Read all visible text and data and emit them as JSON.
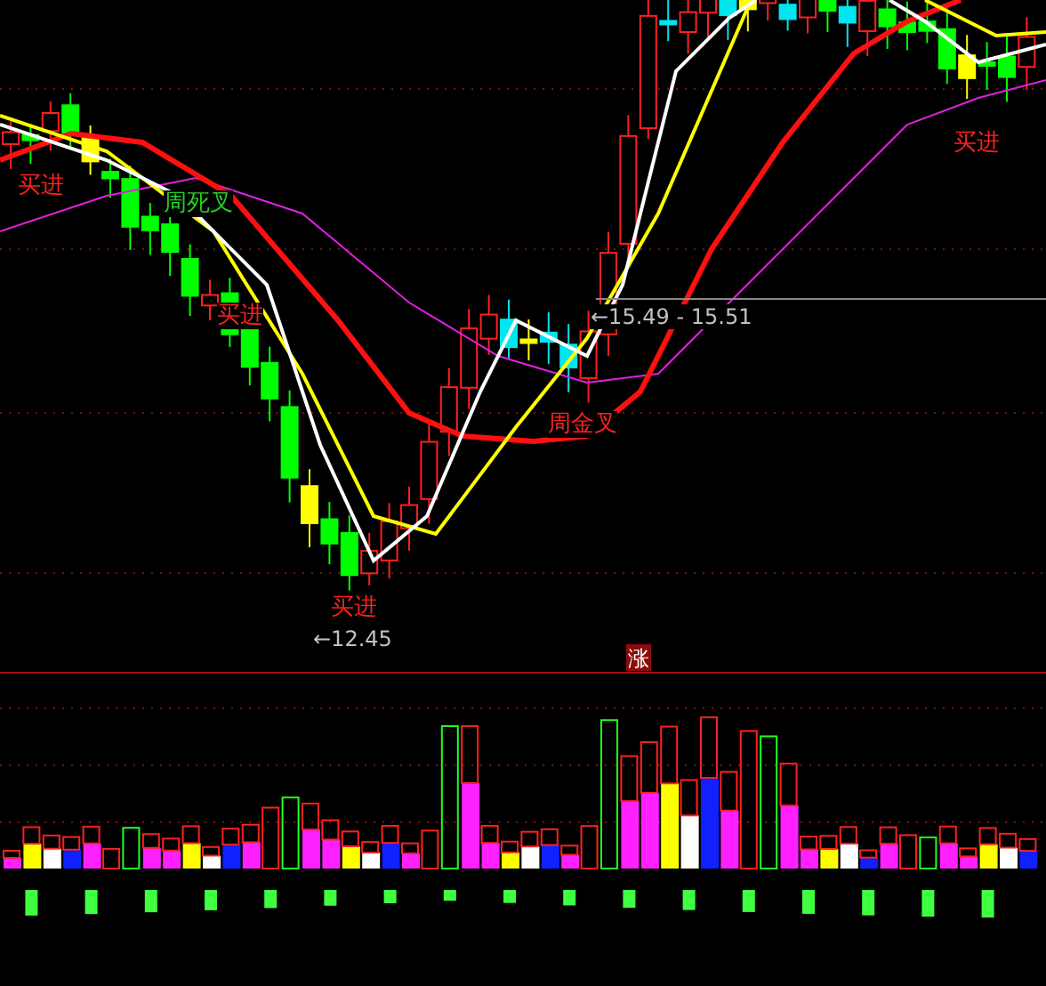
{
  "chart": {
    "annotations": [
      {
        "kind": "buy",
        "text": "买进"
      },
      {
        "kind": "dead-cross",
        "text": "周死叉"
      },
      {
        "kind": "buy",
        "text": "买进"
      },
      {
        "kind": "price-range",
        "text": "←15.49 - 15.51"
      },
      {
        "kind": "golden-cross",
        "text": "周金叉"
      },
      {
        "kind": "buy",
        "text": "买进"
      },
      {
        "kind": "low",
        "text": "←12.45"
      },
      {
        "kind": "buy",
        "text": "买进"
      }
    ],
    "volume_tag": {
      "text": "涨"
    }
  }
}
